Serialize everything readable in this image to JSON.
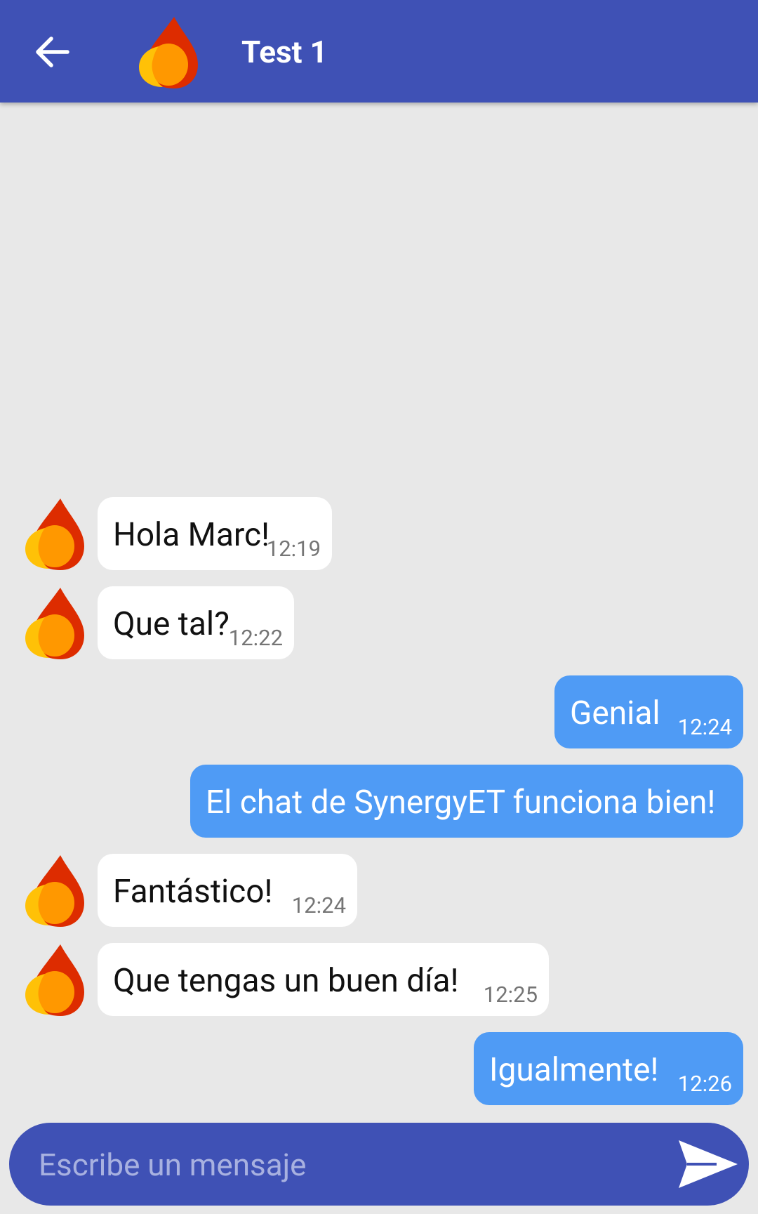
{
  "header": {
    "title": "Test 1",
    "back_icon": "arrow-left-icon",
    "avatar_icon": "flame-avatar-icon"
  },
  "colors": {
    "app_bar": "#3f51b5",
    "background": "#e8e8e8",
    "incoming_bubble": "#ffffff",
    "outgoing_bubble": "#4f9bf5",
    "flame_red": "#dd2c00",
    "flame_orange": "#ff9800",
    "flame_yellow": "#ffc107"
  },
  "messages": [
    {
      "direction": "incoming",
      "text": "Hola Marc!",
      "time": "12:19"
    },
    {
      "direction": "incoming",
      "text": "Que tal?",
      "time": "12:22"
    },
    {
      "direction": "outgoing",
      "text": "Genial",
      "time": "12:24"
    },
    {
      "direction": "outgoing",
      "text": "El chat de SynergyET funciona bien!",
      "time": ""
    },
    {
      "direction": "incoming",
      "text": "Fantástico!",
      "time": "12:24"
    },
    {
      "direction": "incoming",
      "text": "Que tengas un buen día!",
      "time": "12:25"
    },
    {
      "direction": "outgoing",
      "text": "Igualmente!",
      "time": "12:26"
    }
  ],
  "composer": {
    "placeholder": "Escribe un mensaje",
    "value": "",
    "send_icon": "send-icon"
  }
}
